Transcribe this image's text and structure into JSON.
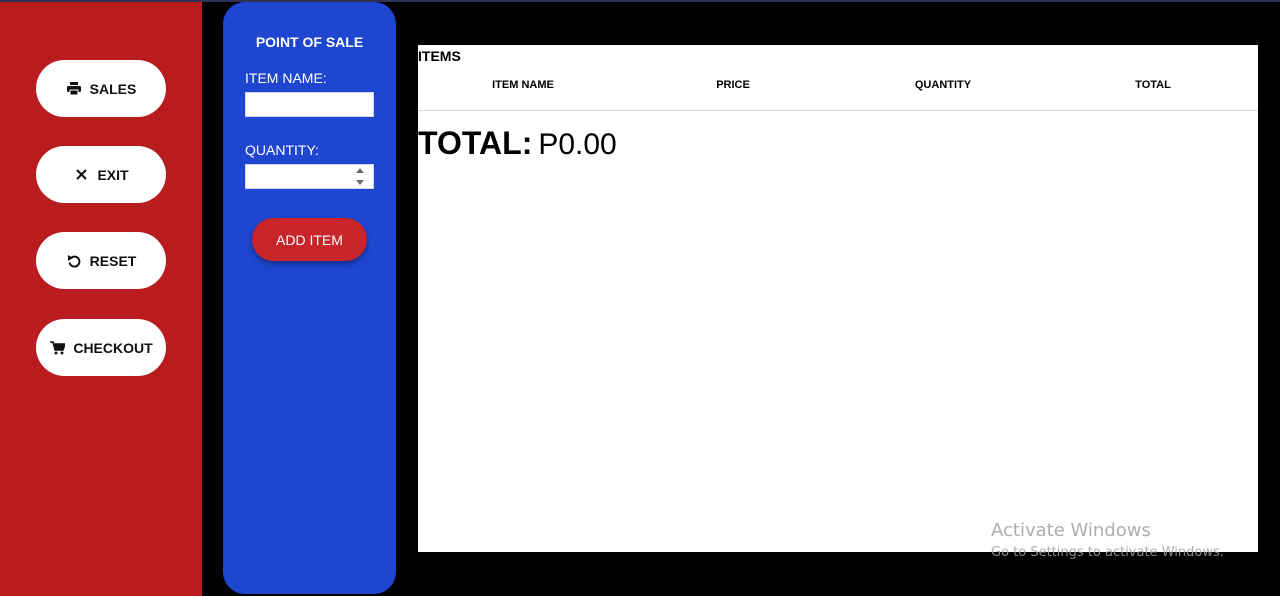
{
  "nav": {
    "buttons": [
      {
        "label": "SALES",
        "icon": "printer-icon"
      },
      {
        "label": "EXIT",
        "icon": "close-icon"
      },
      {
        "label": "RESET",
        "icon": "undo-icon"
      },
      {
        "label": "CHECKOUT",
        "icon": "cart-icon"
      }
    ]
  },
  "form": {
    "title": "POINT OF SALE",
    "item_name_label": "ITEM NAME:",
    "item_name_value": "",
    "quantity_label": "QUANTITY:",
    "quantity_value": "",
    "add_button": "ADD ITEM"
  },
  "items": {
    "title": "ITEMS",
    "columns": [
      "ITEM NAME",
      "PRICE",
      "QUANTITY",
      "TOTAL"
    ],
    "rows": [],
    "total_label": "TOTAL:",
    "total_value": "P0.00"
  },
  "watermark": {
    "line1": "Activate Windows",
    "line2": "Go to Settings to activate Windows."
  },
  "colors": {
    "nav_bg": "#b81c1f",
    "panel_bg": "#1e46d1",
    "add_button_bg": "#c9242a",
    "page_bg": "#000000"
  }
}
